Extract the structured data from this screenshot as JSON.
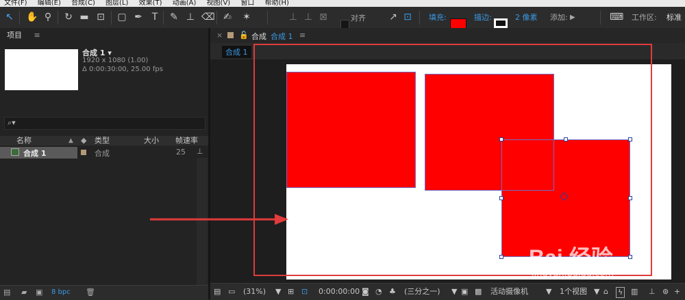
{
  "menubar": {
    "items": [
      "文件(F)",
      "编辑(E)",
      "合成(C)",
      "图层(L)",
      "效果(T)",
      "动画(A)",
      "视图(V)",
      "窗口",
      "帮助(H)"
    ]
  },
  "toolbar": {
    "align_label": "对齐",
    "fill_label": "填充:",
    "stroke_label": "描边:",
    "stroke_width": "2 像素",
    "add_label": "添加:",
    "workspace_label": "工作区:",
    "workspace_value": "标准",
    "fill_color": "#ff0000",
    "stroke_color": "#ffffff"
  },
  "project": {
    "title": "项目",
    "menu_glyph": "≡",
    "comp_name": "合成 1 ▾",
    "comp_resolution": "1920 x 1080 (1.00)",
    "comp_duration": "Δ 0:00:30:00, 25.00 fps",
    "search_glyph": "⌕▾",
    "columns": {
      "name": "名称",
      "type": "类型",
      "size": "大小",
      "fps": "帧速率"
    },
    "rows": [
      {
        "name": "合成 1",
        "type": "合成",
        "fps": "25"
      }
    ],
    "bpc": "8 bpc"
  },
  "comp": {
    "close_glyph": "×",
    "title_prefix": "合成",
    "title_name": "合成 1",
    "menu_glyph": "≡",
    "tab_label": "合成 1"
  },
  "footer": {
    "zoom": "(31%)",
    "timecode": "0:00:00:00",
    "resolution": "(三分之一)",
    "camera": "活动摄像机",
    "views": "1个视图"
  },
  "watermark": {
    "text": "Bai 经验",
    "url": "jingyan.baidu.com"
  }
}
